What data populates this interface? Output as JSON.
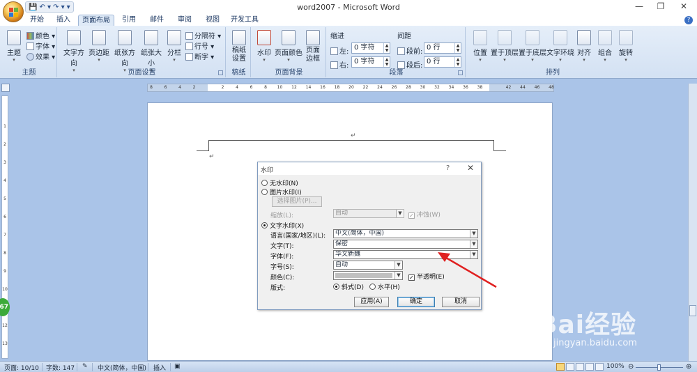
{
  "window": {
    "title": "word2007 - Microsoft Word",
    "minimize": "—",
    "restore": "❐",
    "close": "✕"
  },
  "qat": {
    "save": "💾",
    "undo": "↶ ▾",
    "redo": "↷ ▾",
    "more": "▾"
  },
  "tabs": [
    "开始",
    "插入",
    "页面布局",
    "引用",
    "邮件",
    "审阅",
    "视图",
    "开发工具"
  ],
  "ribbon": {
    "theme_group": {
      "label": "主题",
      "theme_btn": "主题",
      "colors": "颜色 ▾",
      "fonts": "字体 ▾",
      "effects": "效果 ▾"
    },
    "page_setup": {
      "label": "页面设置",
      "text_direction": "文字方向",
      "margins": "页边距",
      "orientation": "纸张方向",
      "size": "纸张大小",
      "columns": "分栏",
      "breaks": "分隔符 ▾",
      "line_numbers": "行号 ▾",
      "hyphenation": "断字 ▾"
    },
    "draft": {
      "label": "稿纸",
      "btn": "稿纸设置"
    },
    "page_background": {
      "label": "页面背景",
      "watermark": "水印",
      "page_color": "页面颜色",
      "page_borders": "页面边框"
    },
    "paragraph": {
      "label": "段落",
      "indent_title": "缩进",
      "spacing_title": "间距",
      "left_label": "左:",
      "left_value": "0 字符",
      "right_label": "右:",
      "right_value": "0 字符",
      "before_label": "段前:",
      "before_value": "0 行",
      "after_label": "段后:",
      "after_value": "0 行"
    },
    "arrange": {
      "label": "排列",
      "position": "位置",
      "bring_front": "置于顶层",
      "send_back": "置于底层",
      "text_wrap": "文字环绕",
      "align": "对齐",
      "group": "组合",
      "rotate": "旋转"
    }
  },
  "ruler": {
    "ticks": [
      "8",
      "6",
      "4",
      "2",
      "",
      "2",
      "4",
      "6",
      "8",
      "10",
      "12",
      "14",
      "16",
      "18",
      "20",
      "22",
      "24",
      "26",
      "28",
      "30",
      "32",
      "34",
      "36",
      "38",
      "",
      "42",
      "44",
      "46",
      "48"
    ],
    "vticks": [
      "1",
      "2",
      "3",
      "4",
      "5",
      "6",
      "7",
      "8",
      "9",
      "10",
      "11",
      "12",
      "13"
    ]
  },
  "document": {
    "para_mark": "↵"
  },
  "dialog": {
    "title": "水印",
    "help": "?",
    "close": "✕",
    "no_watermark": "无水印(N)",
    "picture_watermark": "图片水印(I)",
    "select_picture": "选择图片(P)...",
    "scale_label": "缩放(L):",
    "scale_value": "自动",
    "washout": "冲蚀(W)",
    "text_watermark": "文字水印(X)",
    "language_label": "语言(国家/地区)(L):",
    "language_value": "中文(简体，中国)",
    "text_label": "文字(T):",
    "text_value": "保密",
    "font_label": "字体(F):",
    "font_value": "华文新魏",
    "size_label": "字号(S):",
    "size_value": "自动",
    "color_label": "颜色(C):",
    "semitransparent": "半透明(E)",
    "layout_label": "版式:",
    "diagonal": "斜式(D)",
    "horizontal": "水平(H)",
    "apply": "应用(A)",
    "ok": "确定",
    "cancel": "取消",
    "arrow_color": "#e02020"
  },
  "status": {
    "page": "页面: 10/10",
    "words": "字数: 147",
    "language": "中文(简体，中国)",
    "mode": "插入",
    "zoom": "100%"
  },
  "overlay": {
    "badge": "67",
    "logo_text": "Bai经验",
    "logo_url": "jingyan.baidu.com"
  }
}
